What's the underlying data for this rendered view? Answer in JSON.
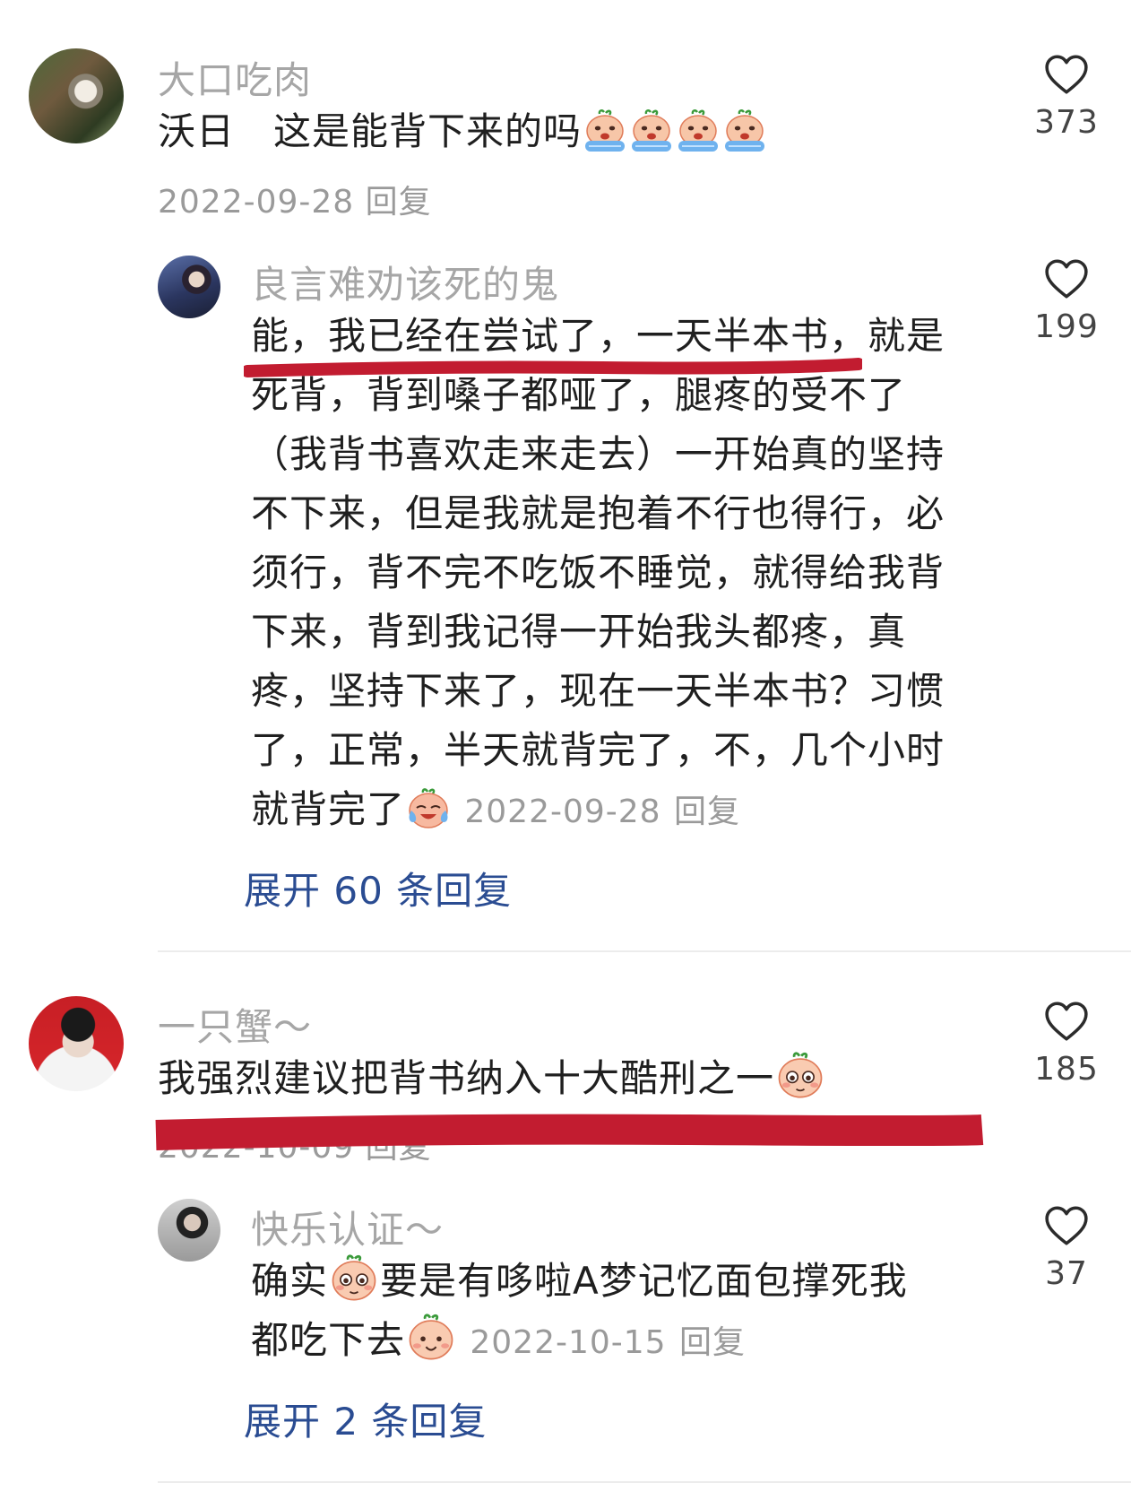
{
  "comments": [
    {
      "user": "大口吃肉",
      "text": "沃日　这是能背下来的吗",
      "date": "2022-09-28",
      "reply_label": "回复",
      "likes": "373",
      "emojis": [
        "crying-emoji",
        "crying-emoji",
        "crying-emoji",
        "crying-emoji"
      ],
      "reply": {
        "user": "良言难劝该死的鬼",
        "lines": [
          "能，我已经在尝试了，一天半本书，就是",
          "死背，背到嗓子都哑了，腿疼的受不了",
          "（我背书喜欢走来走去）一开始真的坚持",
          "不下来，但是我就是抱着不行也得行，必",
          "须行，背不完不吃饭不睡觉，就得给我背",
          "下来，背到我记得一开始我头都疼，真",
          "疼，坚持下来了，现在一天半本书？习惯",
          "了，正常，半天就背完了，不，几个小时",
          "就背完了"
        ],
        "date": "2022-09-28",
        "reply_label": "回复",
        "likes": "199"
      },
      "expand_label": "展开 60 条回复"
    },
    {
      "user": "一只蟹～",
      "text": "我强烈建议把背书纳入十大酷刑之一",
      "date": "2022-10-09",
      "reply_label": "回复",
      "likes": "185",
      "reply": {
        "user": "快乐认证～",
        "line1a": "确实",
        "line1b": "要是有哆啦A梦记忆面包撑死我",
        "line2": "都吃下去",
        "date": "2022-10-15",
        "reply_label": "回复",
        "likes": "37"
      },
      "expand_label": "展开 2 条回复"
    }
  ],
  "colors": {
    "name": "#a6a6a6",
    "expand": "#2a4c92",
    "annotation": "#c21c30"
  },
  "icons": {
    "like": "heart-outline-icon"
  }
}
